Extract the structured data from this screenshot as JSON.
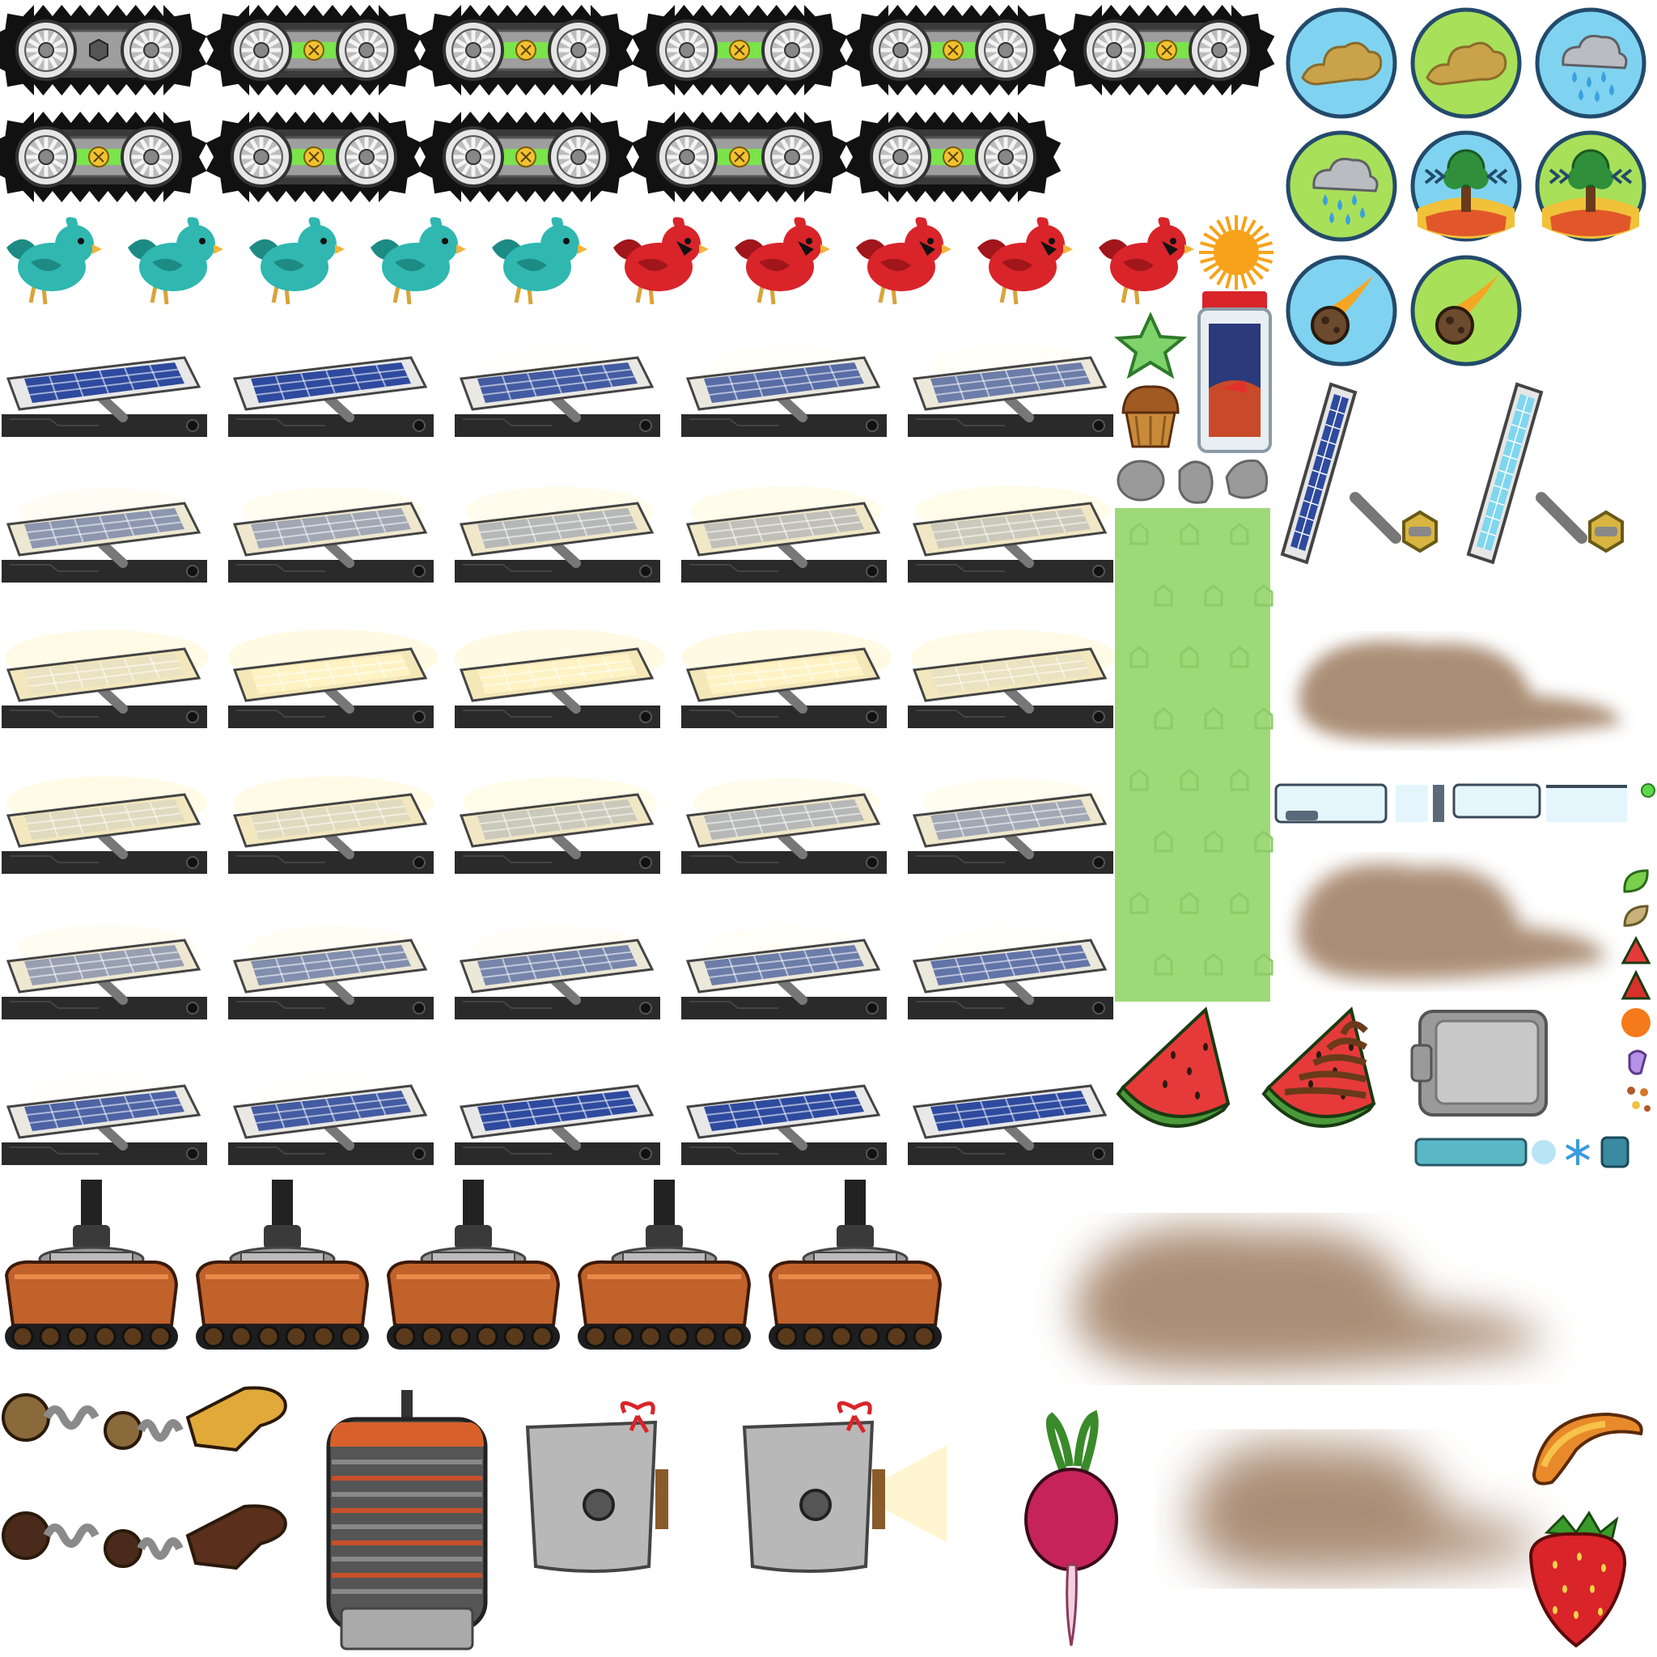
{
  "sheet": {
    "title": "",
    "background": "#ffffff"
  },
  "track_wheels": [
    {
      "name": "track-wheel",
      "variant": "hex-socket",
      "light": "none"
    },
    {
      "name": "track-wheel",
      "variant": "screw",
      "light": "green"
    },
    {
      "name": "track-wheel",
      "variant": "screw",
      "light": "green"
    },
    {
      "name": "track-wheel",
      "variant": "screw",
      "light": "green"
    },
    {
      "name": "track-wheel",
      "variant": "screw",
      "light": "green"
    },
    {
      "name": "track-wheel",
      "variant": "screw",
      "light": "green"
    },
    {
      "name": "track-wheel",
      "variant": "screw",
      "light": "green"
    },
    {
      "name": "track-wheel",
      "variant": "screw",
      "light": "green"
    },
    {
      "name": "track-wheel",
      "variant": "screw",
      "light": "green"
    },
    {
      "name": "track-wheel",
      "variant": "screw",
      "light": "green"
    },
    {
      "name": "track-wheel",
      "variant": "screw",
      "light": "green"
    }
  ],
  "weather_icons": [
    {
      "name": "dust-storm-icon",
      "bg": "#7fd3f0",
      "symbol": "dust-cloud"
    },
    {
      "name": "dust-storm-icon",
      "bg": "#a8e05a",
      "symbol": "dust-cloud"
    },
    {
      "name": "rain-cloud-icon",
      "bg": "#7fd3f0",
      "symbol": "rain"
    },
    {
      "name": "rain-cloud-icon",
      "bg": "#a8e05a",
      "symbol": "rain"
    },
    {
      "name": "earthquake-tree-icon",
      "bg": "#7fd3f0",
      "symbol": "tree"
    },
    {
      "name": "earthquake-tree-icon",
      "bg": "#a8e05a",
      "symbol": "tree"
    },
    {
      "name": "meteor-icon",
      "bg": "#7fd3f0",
      "symbol": "meteor"
    },
    {
      "name": "meteor-icon",
      "bg": "#a8e05a",
      "symbol": "meteor"
    }
  ],
  "birds": [
    {
      "name": "teal-bird",
      "color": "#2fb7b0"
    },
    {
      "name": "teal-bird",
      "color": "#2fb7b0"
    },
    {
      "name": "teal-bird",
      "color": "#2fb7b0"
    },
    {
      "name": "teal-bird",
      "color": "#2fb7b0"
    },
    {
      "name": "teal-bird",
      "color": "#2fb7b0"
    },
    {
      "name": "red-cardinal",
      "color": "#d9242a"
    },
    {
      "name": "red-cardinal",
      "color": "#d9242a"
    },
    {
      "name": "red-cardinal",
      "color": "#d9242a"
    },
    {
      "name": "red-cardinal",
      "color": "#d9242a"
    },
    {
      "name": "red-cardinal",
      "color": "#d9242a"
    }
  ],
  "solar_panel_glow_levels": [
    0,
    0,
    0.1,
    0.2,
    0.3,
    0.45,
    0.55,
    0.65,
    0.7,
    0.75,
    0.9,
    1,
    1,
    1,
    0.9,
    0.85,
    0.85,
    0.75,
    0.65,
    0.55,
    0.5,
    0.4,
    0.35,
    0.3,
    0.25,
    0.15,
    0.1,
    0,
    0,
    0
  ],
  "rover_bodies": [
    {
      "name": "rover-body",
      "color": "#c0622a"
    },
    {
      "name": "rover-body",
      "color": "#c0622a"
    },
    {
      "name": "rover-body",
      "color": "#c0622a"
    },
    {
      "name": "rover-body",
      "color": "#c0622a"
    },
    {
      "name": "rover-body",
      "color": "#c0622a"
    }
  ],
  "arms": [
    {
      "name": "robot-arm-yellow-glove",
      "glove": "#e0a93a"
    },
    {
      "name": "robot-arm-brown-glove",
      "glove": "#5a2f1c"
    }
  ],
  "colors": {
    "track_black": "#111111",
    "panel_frame": "#e8e8e8",
    "panel_cell": "#2e4a9e",
    "panel_glow": "#fff3c4",
    "panel_base": "#2a2a2a",
    "grass": "#9dd977",
    "dust": "#9c7a5f"
  }
}
